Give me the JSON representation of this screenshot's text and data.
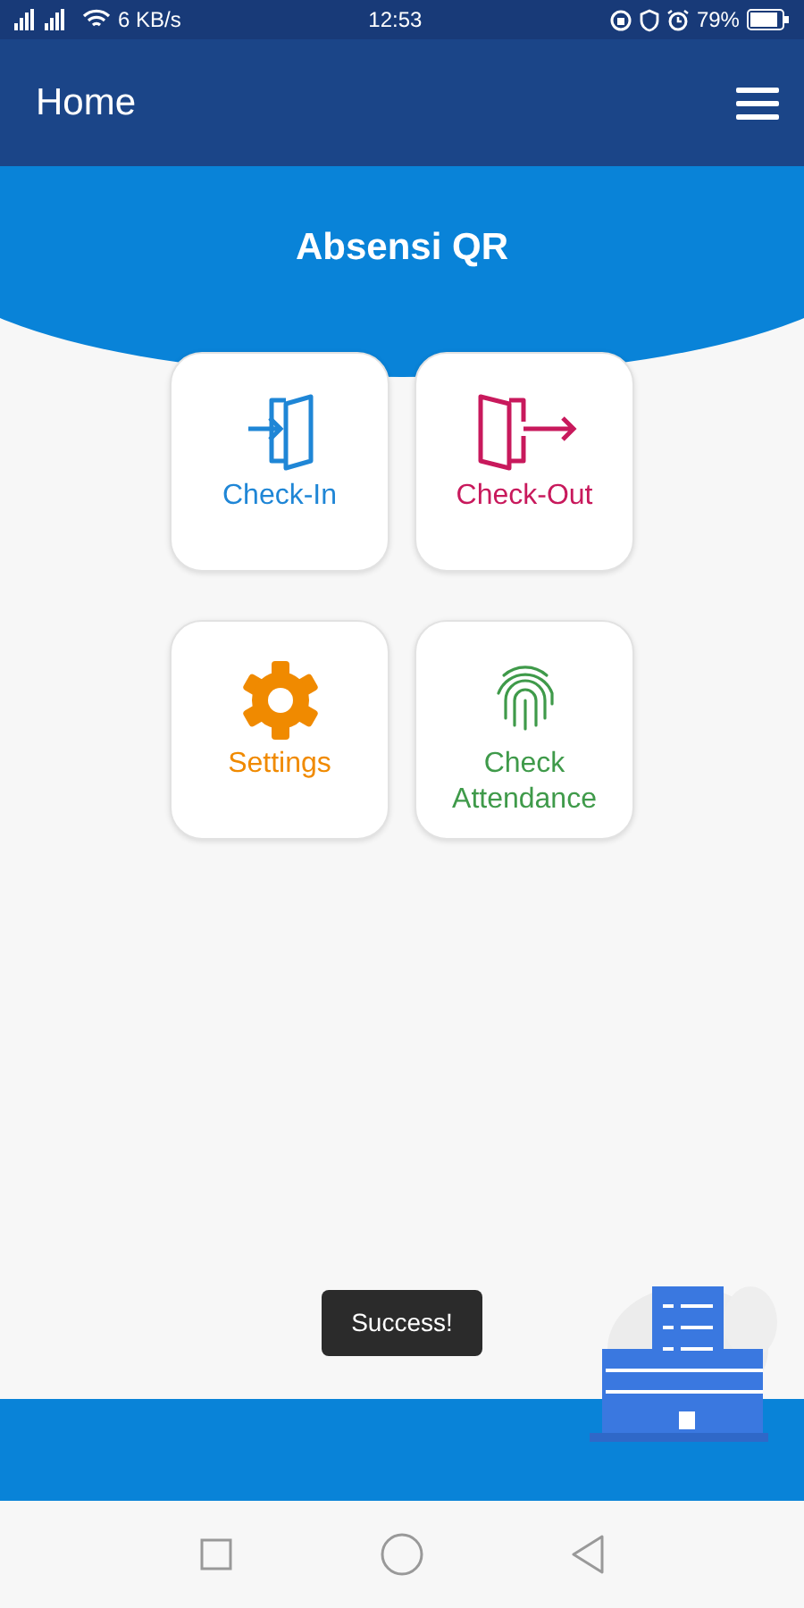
{
  "status_bar": {
    "speed": "6 KB/s",
    "time": "12:53",
    "battery": "79%"
  },
  "app_bar": {
    "title": "Home"
  },
  "header": {
    "title": "Absensi QR"
  },
  "menu": [
    {
      "kind": "check_in",
      "label": "Check-In",
      "color": "#1f86d6"
    },
    {
      "kind": "check_out",
      "label": "Check-Out",
      "color": "#c8195c"
    },
    {
      "kind": "settings",
      "label": "Settings",
      "color": "#f08a00"
    },
    {
      "kind": "attendance",
      "label": "Check Attendance",
      "color": "#3f9a4a"
    }
  ],
  "toast": {
    "text": "Success!"
  }
}
